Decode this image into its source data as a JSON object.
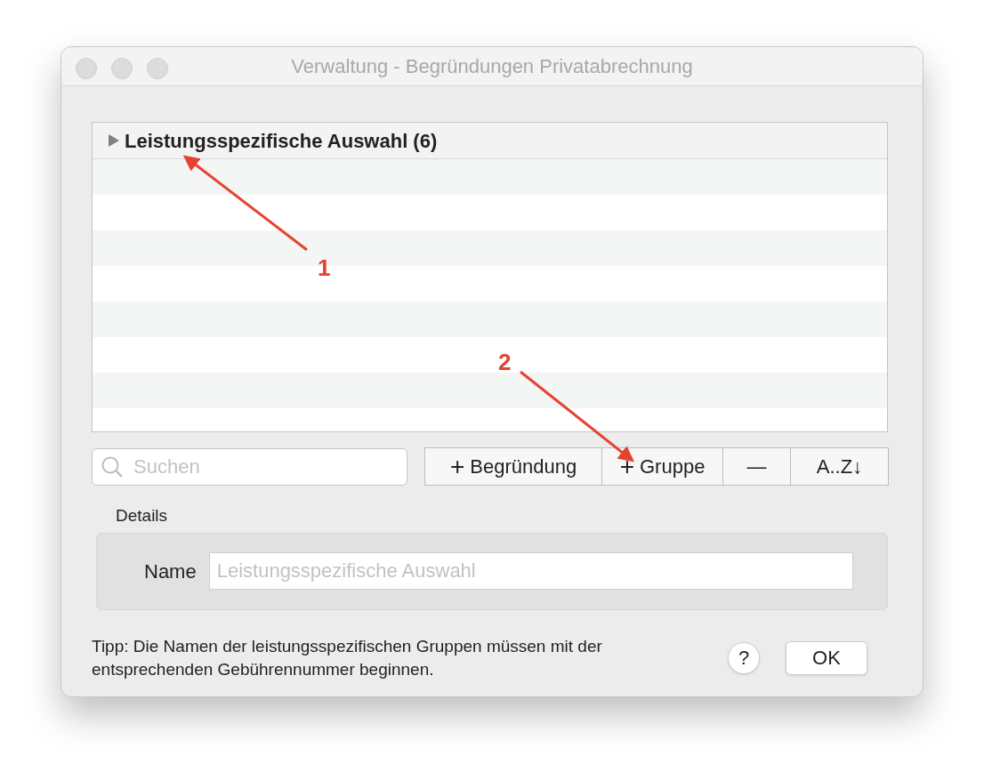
{
  "window": {
    "title": "Verwaltung - Begründungen Privatabrechnung"
  },
  "list": {
    "group": {
      "label": "Leistungsspezifische Auswahl (6)",
      "expanded": false
    }
  },
  "search": {
    "placeholder": "Suchen"
  },
  "toolbar": [
    {
      "icon": "+",
      "label": "Begründung"
    },
    {
      "icon": "+",
      "label": "Gruppe"
    },
    {
      "label": "—"
    },
    {
      "label": "A..Z↓"
    }
  ],
  "details": {
    "title": "Details",
    "name_label": "Name",
    "name_placeholder": "Leistungsspezifische Auswahl"
  },
  "tip": "Tipp: Die Namen der leistungsspezifischen Gruppen müssen mit der entsprechenden Gebührennummer beginnen.",
  "help_button": "?",
  "ok_button": "OK",
  "annotations": [
    {
      "number": "1"
    },
    {
      "number": "2"
    }
  ]
}
